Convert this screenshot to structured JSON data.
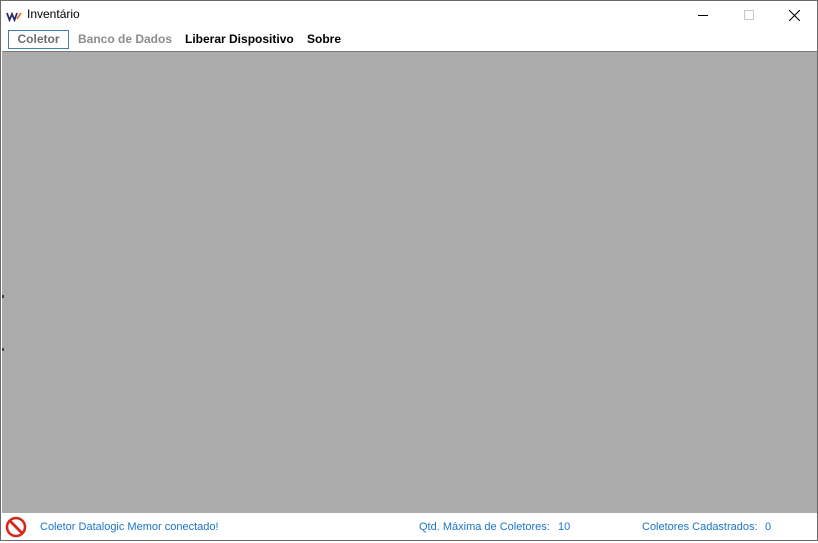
{
  "window": {
    "title": "Inventário",
    "icon": "app-logo-icon"
  },
  "menu": {
    "items": [
      {
        "label": "Coletor",
        "state": "active"
      },
      {
        "label": "Banco de Dados",
        "state": "disabled"
      },
      {
        "label": "Liberar Dispositivo",
        "state": "normal"
      },
      {
        "label": "Sobre",
        "state": "normal"
      }
    ]
  },
  "status": {
    "icon": "no-entry-icon",
    "message": "Coletor Datalogic Memor conectado!",
    "qtd_label": "Qtd. Máxima de Coletores:",
    "qtd_value": "10",
    "cadastrados_label": "Coletores Cadastrados:",
    "cadastrados_value": "0"
  },
  "colors": {
    "client_background": "#ababab",
    "status_text": "#1a74c9",
    "active_menu_border": "#3c7fb1",
    "status_icon": "#d9261c"
  }
}
